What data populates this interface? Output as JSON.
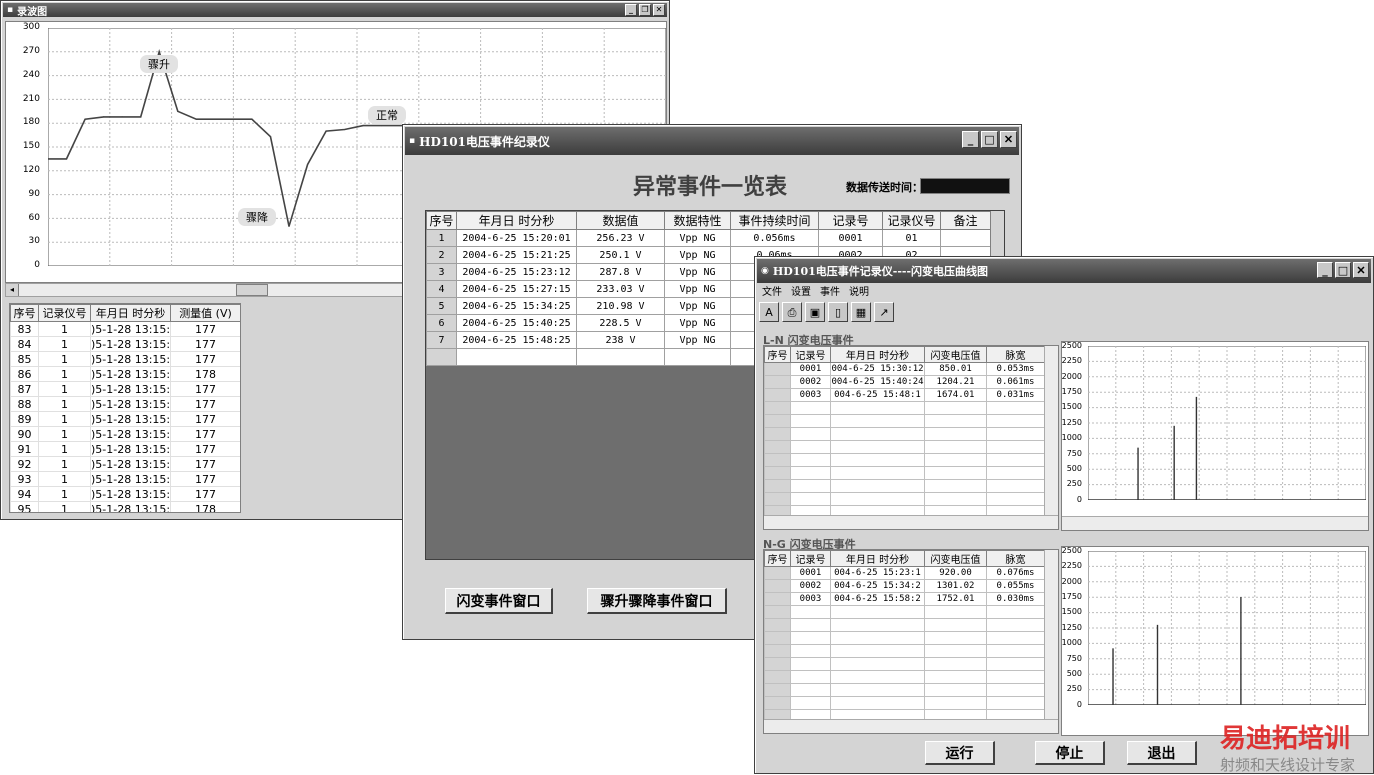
{
  "wave_window": {
    "title": "录波图",
    "y_ticks": [
      "300",
      "270",
      "240",
      "210",
      "180",
      "150",
      "120",
      "90",
      "60",
      "30",
      "0"
    ],
    "callouts": {
      "surge": "骤升",
      "normal": "正常",
      "drop": "骤降"
    },
    "headers": [
      "序号",
      "记录仪号",
      "年月日 时分秒",
      "测量值 (V)"
    ],
    "rows": [
      [
        "83",
        "1",
        ")5-1-28 13:15:",
        "177"
      ],
      [
        "84",
        "1",
        ")5-1-28 13:15:",
        "177"
      ],
      [
        "85",
        "1",
        ")5-1-28 13:15:",
        "177"
      ],
      [
        "86",
        "1",
        ")5-1-28 13:15:",
        "178"
      ],
      [
        "87",
        "1",
        ")5-1-28 13:15:",
        "177"
      ],
      [
        "88",
        "1",
        ")5-1-28 13:15:",
        "177"
      ],
      [
        "89",
        "1",
        ")5-1-28 13:15:",
        "177"
      ],
      [
        "90",
        "1",
        ")5-1-28 13:15:",
        "177"
      ],
      [
        "91",
        "1",
        ")5-1-28 13:15:",
        "177"
      ],
      [
        "92",
        "1",
        ")5-1-28 13:15:",
        "177"
      ],
      [
        "93",
        "1",
        ")5-1-28 13:15:",
        "177"
      ],
      [
        "94",
        "1",
        ")5-1-28 13:15:",
        "177"
      ],
      [
        "95",
        "1",
        ")5-1-28 13:15:",
        "178"
      ]
    ]
  },
  "event_window": {
    "title": "HD101电压事件纪录仪",
    "heading": "异常事件一览表",
    "send_time_label": "数据传送时间：",
    "headers": [
      "序号",
      "年月日 时分秒",
      "数据值",
      "数据特性",
      "事件持续时间",
      "记录号",
      "记录仪号",
      "备注"
    ],
    "rows": [
      [
        "1",
        "2004-6-25 15:20:01",
        "256.23 V",
        "Vpp NG",
        "0.056ms",
        "0001",
        "01",
        ""
      ],
      [
        "2",
        "2004-6-25 15:21:25",
        "250.1 V",
        "Vpp NG",
        "0.06ms",
        "0002",
        "02",
        ""
      ],
      [
        "3",
        "2004-6-25 15:23:12",
        "287.8 V",
        "Vpp NG",
        "",
        "",
        "",
        ""
      ],
      [
        "4",
        "2004-6-25 15:27:15",
        "233.03 V",
        "Vpp NG",
        "",
        "",
        "",
        ""
      ],
      [
        "5",
        "2004-6-25 15:34:25",
        "210.98 V",
        "Vpp NG",
        "",
        "",
        "",
        ""
      ],
      [
        "6",
        "2004-6-25 15:40:25",
        "228.5 V",
        "Vpp NG",
        "",
        "",
        "",
        ""
      ],
      [
        "7",
        "2004-6-25 15:48:25",
        "238 V",
        "Vpp NG",
        "",
        "",
        "",
        ""
      ]
    ],
    "buttons": {
      "flicker": "闪变事件窗口",
      "surge_drop": "骤升骤降事件窗口"
    }
  },
  "flicker_window": {
    "title": "HD101电压事件记录仪----闪变电压曲线图",
    "menu": [
      "文件",
      "设置",
      "事件",
      "说明"
    ],
    "toolbar_icons": [
      "text-tool-icon",
      "print-icon",
      "save-icon",
      "page-icon",
      "chart-view-icon",
      "line-chart-icon"
    ],
    "ln_section": {
      "label": "L-N  闪变电压事件",
      "headers": [
        "序号",
        "记录号",
        "年月日 时分秒",
        "闪变电压值",
        "脉宽"
      ],
      "rows": [
        [
          "",
          "0001",
          "004-6-25 15:30:12",
          "850.01",
          "0.053ms"
        ],
        [
          "",
          "0002",
          "004-6-25 15:40:24",
          "1204.21",
          "0.061ms"
        ],
        [
          "",
          "0003",
          "004-6-25 15:48:1",
          "1674.01",
          "0.031ms"
        ]
      ]
    },
    "ng_section": {
      "label": "N-G  闪变电压事件",
      "headers": [
        "序号",
        "记录号",
        "年月日 时分秒",
        "闪变电压值",
        "脉宽"
      ],
      "rows": [
        [
          "",
          "0001",
          "004-6-25 15:23:1",
          "920.00",
          "0.076ms"
        ],
        [
          "",
          "0002",
          "004-6-25 15:34:2",
          "1301.02",
          "0.055ms"
        ],
        [
          "",
          "0003",
          "004-6-25 15:58:2",
          "1752.01",
          "0.030ms"
        ]
      ]
    },
    "buttons": {
      "run": "运行",
      "stop": "停止",
      "exit": "退出"
    }
  },
  "watermark": {
    "brand": "易迪拓培训",
    "tagline": "射频和天线设计专家"
  },
  "chart_data": [
    {
      "type": "line",
      "title": "",
      "ylim": [
        0,
        300
      ],
      "y_ticks": [
        0,
        30,
        60,
        90,
        120,
        150,
        180,
        210,
        240,
        270,
        300
      ],
      "grid": true,
      "x": [
        0,
        0.03,
        0.06,
        0.09,
        0.12,
        0.15,
        0.18,
        0.21,
        0.24,
        0.27,
        0.3,
        0.33,
        0.36,
        0.39,
        0.42,
        0.45,
        0.48,
        0.51,
        0.54,
        0.57,
        0.6,
        0.63,
        0.66,
        0.69,
        0.72,
        0.75,
        0.78,
        0.81,
        0.84,
        0.87,
        0.9,
        0.93,
        0.96,
        1.0
      ],
      "values": [
        135,
        135,
        185,
        188,
        188,
        188,
        270,
        195,
        185,
        185,
        185,
        185,
        163,
        50,
        128,
        170,
        172,
        177,
        177,
        177,
        177,
        177,
        177,
        177,
        177,
        177,
        177,
        177,
        177,
        177,
        177,
        177,
        177,
        177
      ]
    },
    {
      "type": "bar",
      "title": "",
      "ylim": [
        0,
        2500
      ],
      "y_ticks": [
        0,
        250,
        500,
        750,
        1000,
        1250,
        1500,
        1750,
        2000,
        2250,
        2500
      ],
      "grid": true,
      "x": [
        0.18,
        0.31,
        0.39
      ],
      "values": [
        850.01,
        1204.21,
        1674.01
      ]
    },
    {
      "type": "bar",
      "title": "",
      "ylim": [
        0,
        2500
      ],
      "y_ticks": [
        0,
        250,
        500,
        750,
        1000,
        1250,
        1500,
        1750,
        2000,
        2250,
        2500
      ],
      "grid": true,
      "x": [
        0.09,
        0.25,
        0.55
      ],
      "values": [
        920.0,
        1301.02,
        1752.01
      ]
    }
  ]
}
